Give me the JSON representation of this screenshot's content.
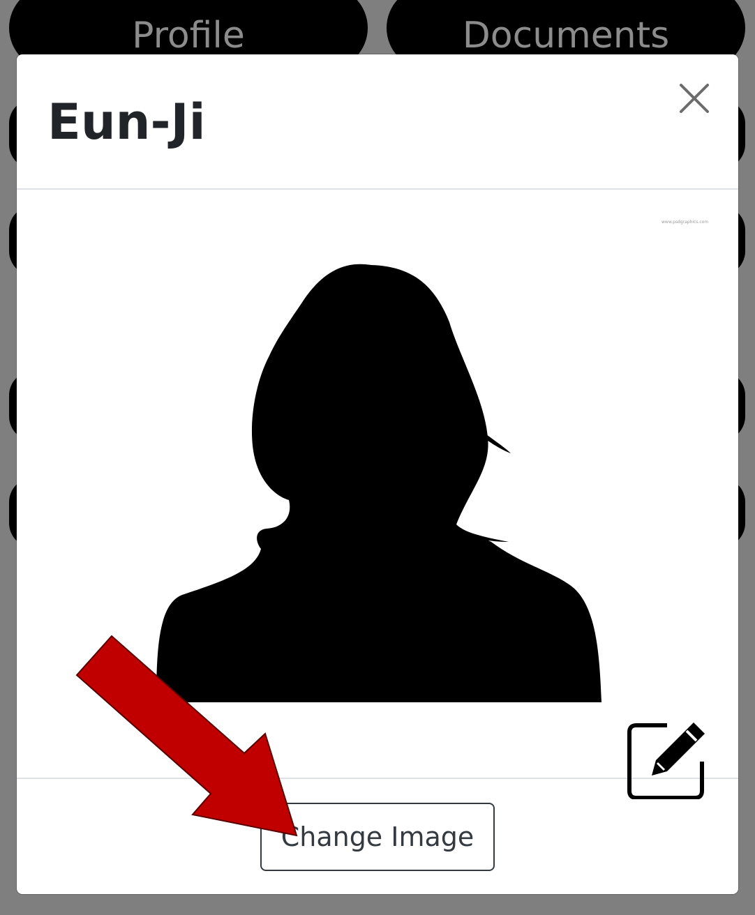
{
  "background": {
    "tabs": [
      {
        "label": "Profile"
      },
      {
        "label": "Documents"
      }
    ]
  },
  "modal": {
    "title": "Eun-Ji",
    "close_icon": "close-icon",
    "image": {
      "watermark": "www.psdgraphics.com",
      "edit_icon": "edit-pencil-icon"
    },
    "footer": {
      "change_image_label": "Change Image"
    }
  },
  "annotation": {
    "arrow_color": "#c00000",
    "arrow_icon": "arrow-pointer-icon"
  }
}
